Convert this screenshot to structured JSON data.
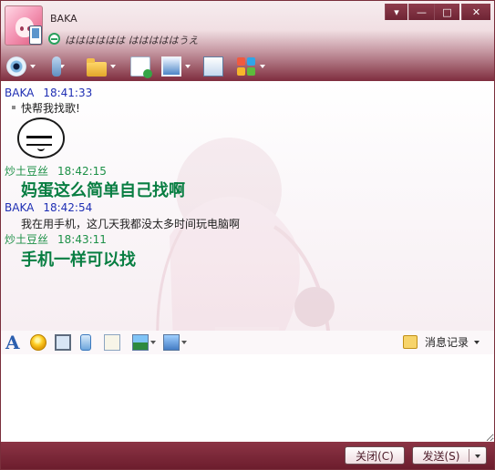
{
  "window": {
    "contact_name": "BAKA",
    "signature": "はははははは はははははうえ",
    "controls": [
      "▾",
      "—",
      "□",
      "✕"
    ]
  },
  "toolbar": {
    "icons": [
      "camera-icon",
      "microphone-icon",
      "folder-icon",
      "note-icon",
      "remote-screen-icon",
      "share-screen-icon",
      "apps-icon"
    ]
  },
  "chat": {
    "messages": [
      {
        "sender": "BAKA",
        "time": "18:41:33",
        "text": "快帮我找歌!"
      },
      {
        "sender": "炒土豆丝",
        "time": "18:42:15",
        "text": "妈蛋这么简单自己找啊"
      },
      {
        "sender": "BAKA",
        "time": "18:42:54",
        "text": "我在用手机，这几天我都没太多时间玩电脑啊"
      },
      {
        "sender": "炒土豆丝",
        "time": "18:43:11",
        "text": "手机一样可以找"
      }
    ]
  },
  "input_toolbar": {
    "history_label": "消息记录"
  },
  "buttons": {
    "close_label": "关闭(C)",
    "send_label": "发送(S)"
  },
  "colors": {
    "accent": "#7a2f3c",
    "sender_blue": "#1f2fb4",
    "sender_green": "#1d9047",
    "big_text_green": "#087e42"
  }
}
